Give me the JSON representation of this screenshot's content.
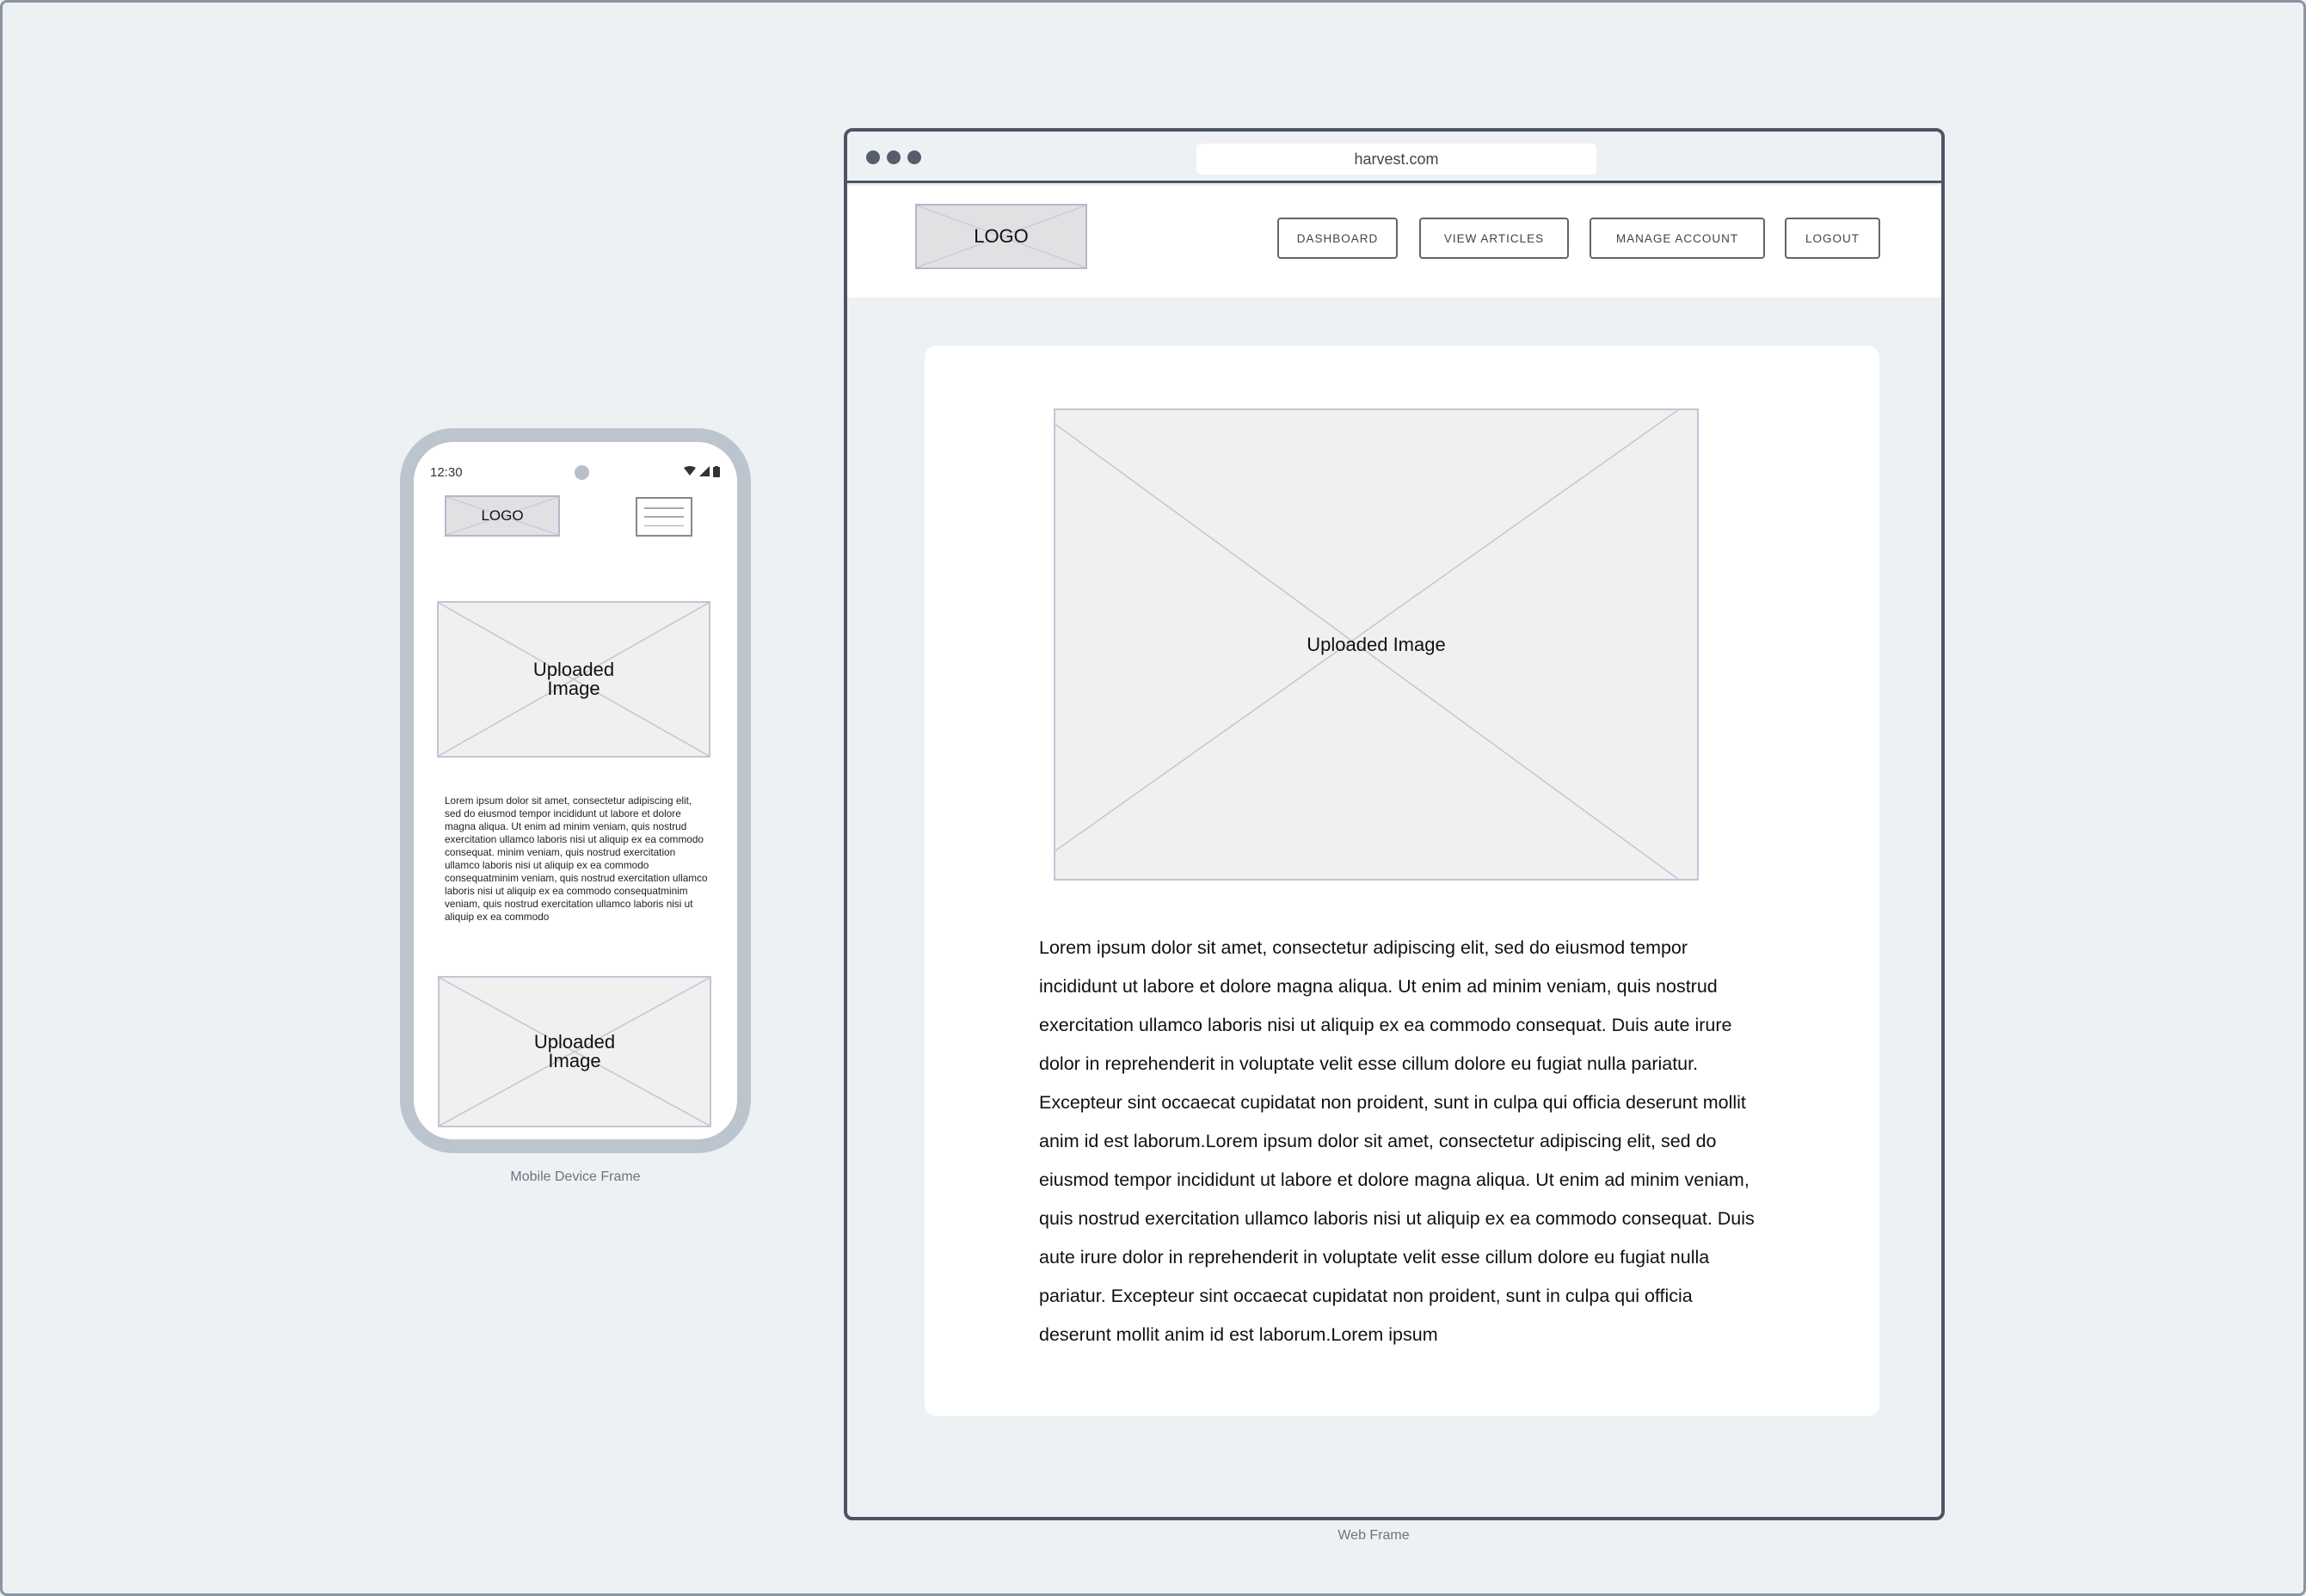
{
  "mobile": {
    "status_time": "12:30",
    "logo": "LOGO",
    "image1_label": "Uploaded Image",
    "body_text": "Lorem ipsum dolor sit amet, consectetur adipiscing elit, sed do eiusmod tempor incididunt ut labore et dolore magna aliqua. Ut enim ad minim veniam, quis nostrud exercitation ullamco laboris nisi ut aliquip ex ea commodo consequat. minim veniam, quis nostrud exercitation ullamco laboris nisi ut aliquip ex ea commodo consequatminim veniam, quis nostrud exercitation ullamco laboris nisi ut aliquip ex ea commodo consequatminim veniam, quis nostrud exercitation ullamco laboris nisi ut aliquip ex ea commodo",
    "image2_label": "Uploaded Image",
    "caption": "Mobile Device Frame"
  },
  "web": {
    "url": "harvest.com",
    "logo": "LOGO",
    "nav": [
      "DASHBOARD",
      "VIEW ARTICLES",
      "MANAGE ACCOUNT",
      "LOGOUT"
    ],
    "image_label": "Uploaded Image",
    "body_text": "Lorem ipsum dolor sit amet, consectetur adipiscing elit, sed do eiusmod tempor incididunt ut labore et dolore magna aliqua. Ut enim ad minim veniam, quis nostrud exercitation ullamco laboris nisi ut aliquip ex ea commodo consequat. Duis aute irure dolor in reprehenderit in voluptate velit esse cillum dolore eu fugiat nulla pariatur. Excepteur sint occaecat cupidatat non proident, sunt in culpa qui officia deserunt mollit anim id est laborum.Lorem ipsum dolor sit amet, consectetur adipiscing elit, sed do eiusmod tempor incididunt ut labore et dolore magna aliqua. Ut enim ad minim veniam, quis nostrud exercitation ullamco laboris nisi ut aliquip ex ea commodo consequat. Duis aute irure dolor in reprehenderit in voluptate velit esse cillum dolore eu fugiat nulla pariatur. Excepteur sint occaecat cupidatat non proident, sunt in culpa qui officia deserunt mollit anim id est laborum.Lorem ipsum",
    "caption": "Web Frame"
  },
  "colors": {
    "background": "#edf1f4",
    "frame_border": "#4c5562",
    "phone_bezel": "#bcc4ce",
    "placeholder_fill": "#f0f0f0",
    "placeholder_stroke": "#c3c5d5"
  }
}
